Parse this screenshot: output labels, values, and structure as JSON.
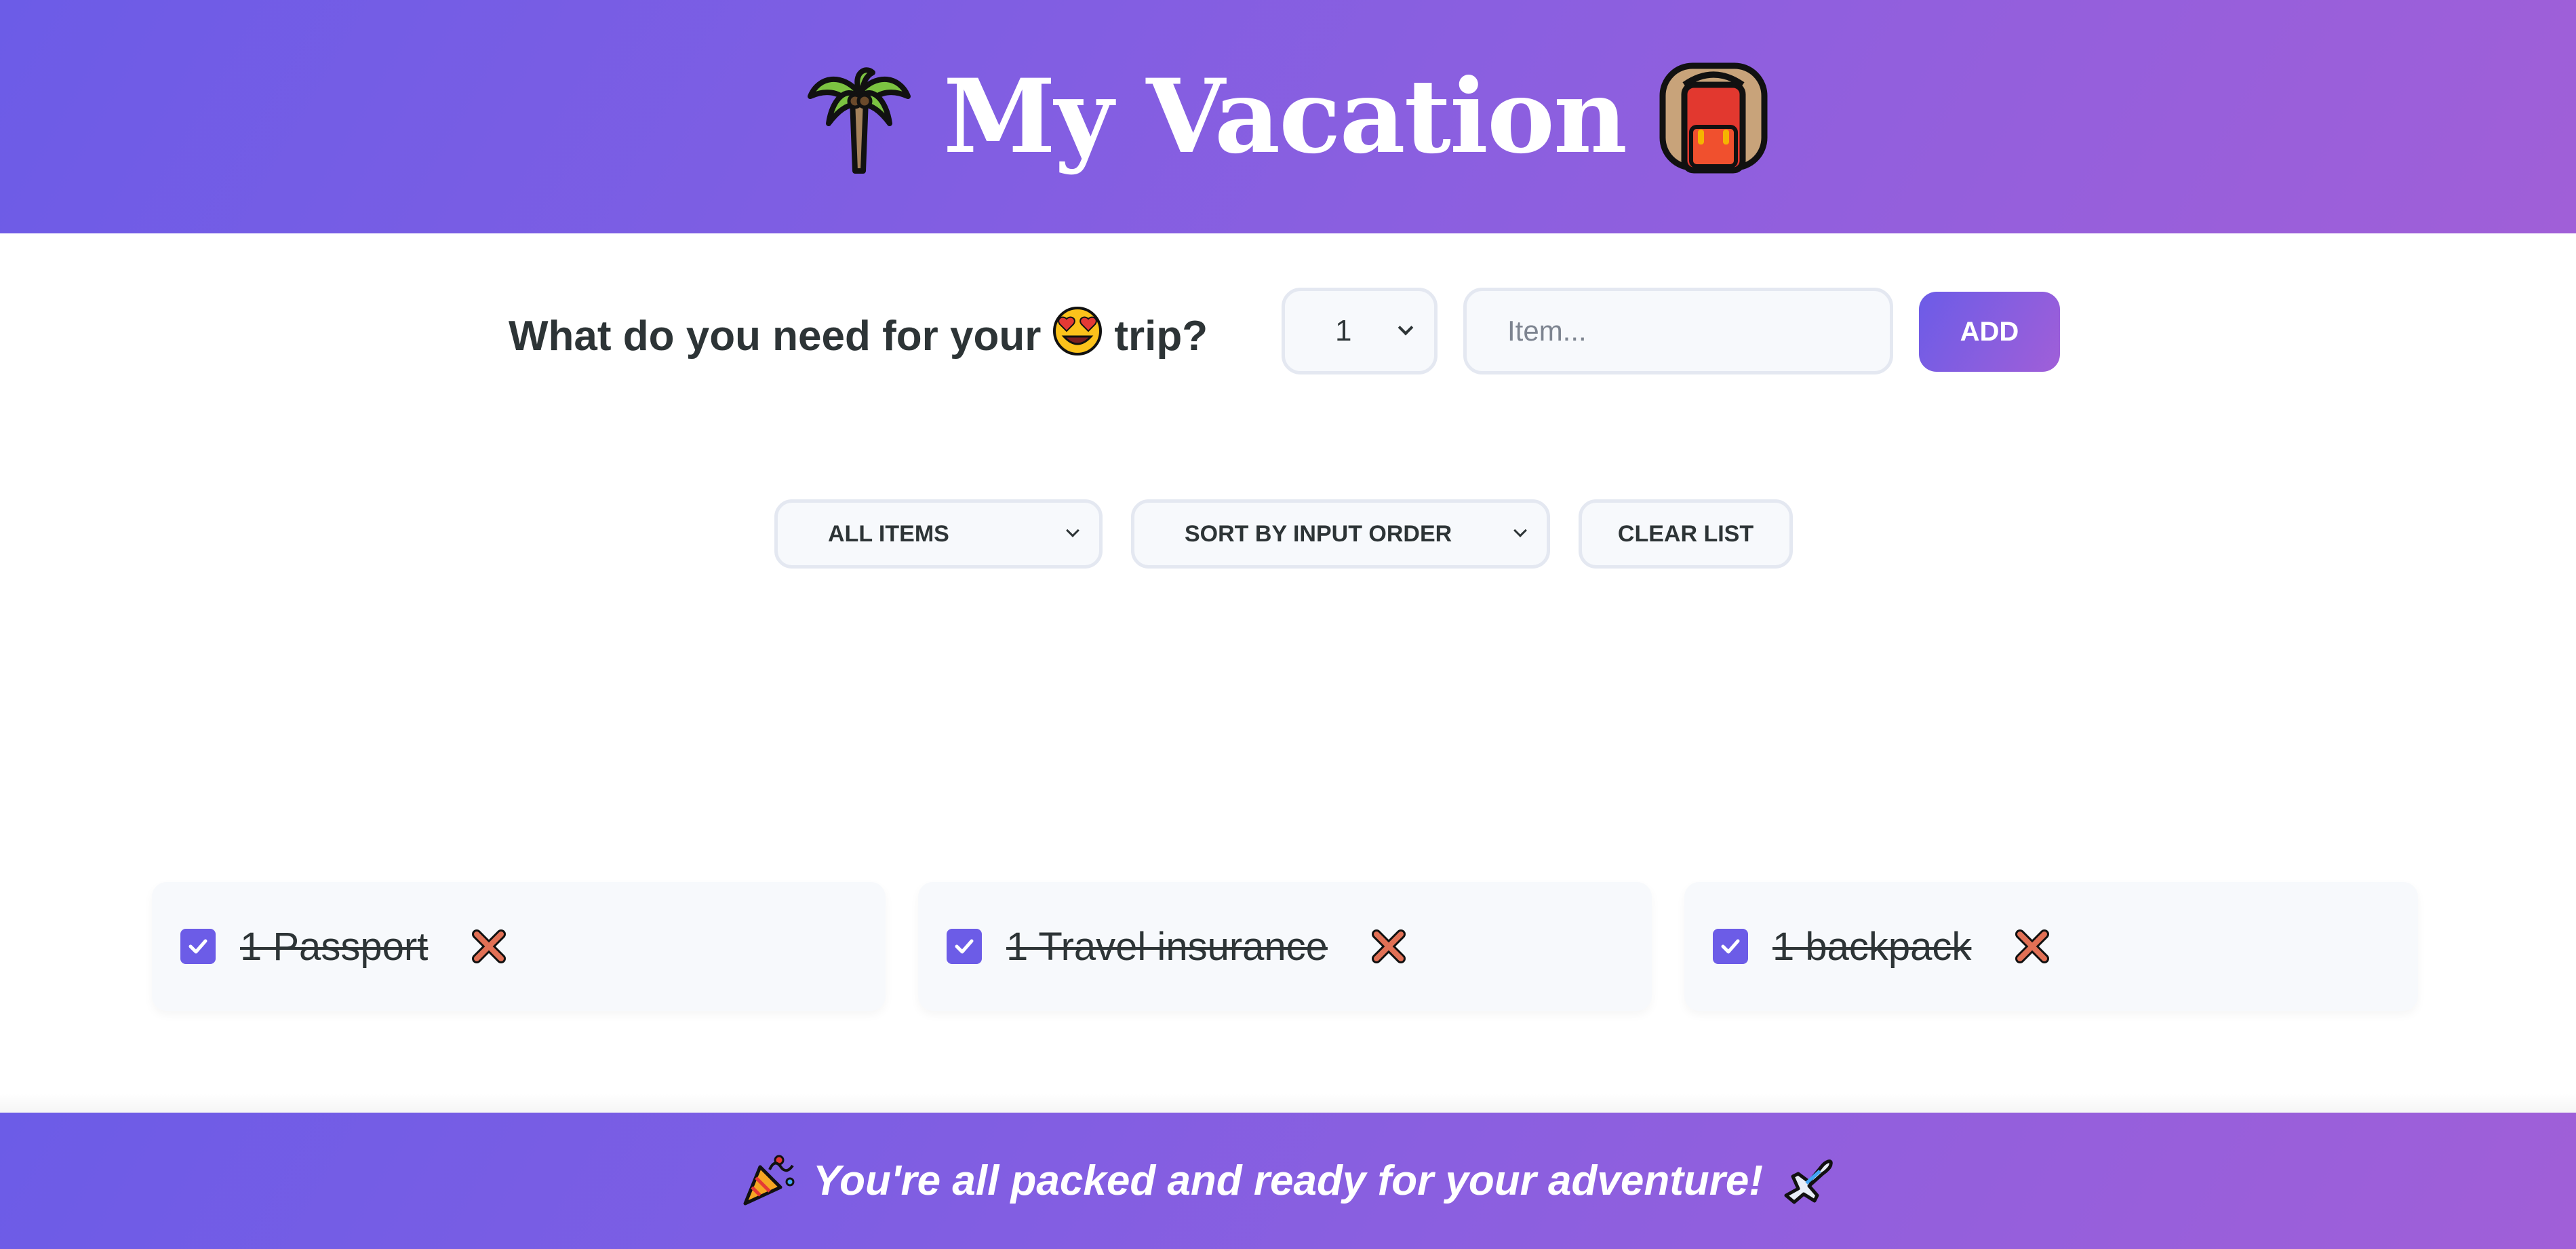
{
  "header": {
    "title": "My Vacation",
    "left_icon": "palm-tree-icon",
    "right_icon": "backpack-icon"
  },
  "form": {
    "question_prefix": "What do you need for your",
    "question_icon": "heart-eyes-emoji-icon",
    "question_suffix": "trip?",
    "quantity_value": "1",
    "item_placeholder": "Item...",
    "add_label": "ADD"
  },
  "actions": {
    "filter_value": "ALL ITEMS",
    "sort_value": "SORT BY INPUT ORDER",
    "clear_label": "CLEAR LIST"
  },
  "items": [
    {
      "label": "1 Passport",
      "packed": true
    },
    {
      "label": "1 Travel insurance",
      "packed": true
    },
    {
      "label": "1 backpack",
      "packed": true
    }
  ],
  "footer": {
    "message": "You're all packed and ready for your adventure!",
    "left_icon": "party-popper-icon",
    "right_icon": "airplane-icon"
  },
  "colors": {
    "accent": "#6c5ce7",
    "accent_end": "#a05fd8",
    "text": "#2d3436",
    "delete": "#e17055"
  }
}
